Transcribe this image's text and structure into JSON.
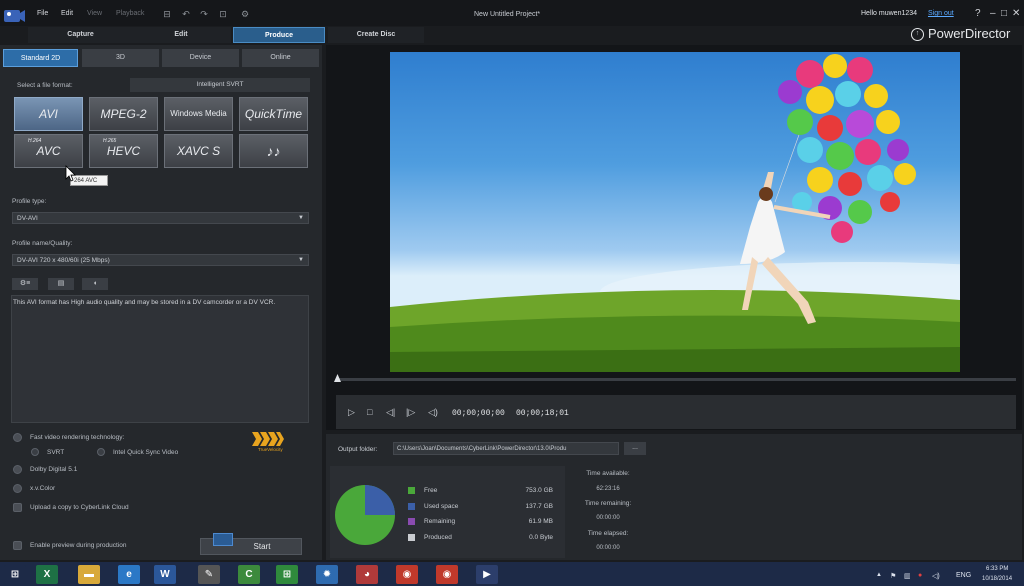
{
  "menu": {
    "file": "File",
    "edit": "Edit",
    "view": "View",
    "playback": "Playback"
  },
  "window": {
    "title": "New Untitled Project*",
    "greeting": "Hello muwen1234",
    "sign_out": "Sign out",
    "help": "?",
    "minimize": "–",
    "restore": "□",
    "close": "✕"
  },
  "tabs": {
    "capture": "Capture",
    "edit": "Edit",
    "produce": "Produce",
    "create_disc": "Create Disc"
  },
  "brand": "PowerDirector",
  "subtabs": [
    "Standard 2D",
    "3D",
    "Device",
    "Online"
  ],
  "format": {
    "select_label": "Select a file format:",
    "svrt_label": "Intelligent SVRT",
    "buttons": [
      {
        "label": "AVI",
        "sup": ""
      },
      {
        "label": "MPEG-2",
        "sup": ""
      },
      {
        "label": "Windows Media",
        "sup": ""
      },
      {
        "label": "QuickTime",
        "sup": ""
      },
      {
        "label": "AVC",
        "sup": "H.264"
      },
      {
        "label": "HEVC",
        "sup": "H.265"
      },
      {
        "label": "XAVC S",
        "sup": ""
      },
      {
        "label": "♪♪",
        "sup": ""
      }
    ],
    "tooltip": "264 AVC"
  },
  "profile": {
    "type_label": "Profile type:",
    "type_value": "DV-AVI",
    "name_label": "Profile name/Quality:",
    "name_value": "DV-AVI 720 x 480/60i (25 Mbps)",
    "description": "This AVI format has High audio quality and may be stored in a DV camcorder or a DV VCR."
  },
  "options": {
    "fast_render": "Fast video rendering technology:",
    "svrt": "SVRT",
    "quick_sync": "Intel Quick Sync Video",
    "dolby": "Dolby Digital 5.1",
    "xvcolor": "x.v.Color",
    "upload": "Upload a copy to CyberLink Cloud",
    "enable_preview": "Enable preview during production",
    "start": "Start",
    "velocity_label": "TrueVelocity"
  },
  "player": {
    "current_time": "00;00;00;00",
    "total_time": "00;00;18;01"
  },
  "output": {
    "folder_label": "Output folder:",
    "folder_path": "C:\\Users\\Joan\\Documents\\CyberLink\\PowerDirector\\13.0\\Produ",
    "browse": "...",
    "legend": [
      {
        "label": "Free",
        "value": "753.0 GB",
        "color": "#4aa83a"
      },
      {
        "label": "Used space",
        "value": "137.7 GB",
        "color": "#3b5fa8"
      },
      {
        "label": "Remaining",
        "value": "61.9 MB",
        "color": "#8a4bb0"
      },
      {
        "label": "Produced",
        "value": "0.0 Byte",
        "color": "#c9ccd0"
      }
    ],
    "time_available_label": "Time available:",
    "time_available": "62:23:16",
    "time_remaining_label": "Time remaining:",
    "time_remaining": "00:00:00",
    "time_elapsed_label": "Time elapsed:",
    "time_elapsed": "00:00:00"
  },
  "taskbar": {
    "lang": "ENG",
    "time": "6:33 PM",
    "date": "10/18/2014",
    "apps": [
      {
        "name": "windows-start",
        "glyph": "⊞",
        "color": "#1d2a47"
      },
      {
        "name": "excel",
        "glyph": "X",
        "color": "#1e7145"
      },
      {
        "name": "file-explorer",
        "glyph": "▬",
        "color": "#d8a93a"
      },
      {
        "name": "internet-explorer",
        "glyph": "e",
        "color": "#2b78c6"
      },
      {
        "name": "word",
        "glyph": "W",
        "color": "#2b579a"
      },
      {
        "name": "pen-tool",
        "glyph": "✎",
        "color": "#555"
      },
      {
        "name": "camtasia",
        "glyph": "C",
        "color": "#3c8a3c"
      },
      {
        "name": "spreadsheet",
        "glyph": "⊞",
        "color": "#2f8a3c"
      },
      {
        "name": "settings-gear",
        "glyph": "✹",
        "color": "#2e6bb0"
      },
      {
        "name": "paint",
        "glyph": "◕",
        "color": "#b03a3a"
      },
      {
        "name": "chrome",
        "glyph": "◉",
        "color": "#c0392b"
      },
      {
        "name": "chrome-2",
        "glyph": "◉",
        "color": "#c0392b"
      },
      {
        "name": "powerdirector",
        "glyph": "▶",
        "color": "#2c3e6b"
      }
    ]
  }
}
